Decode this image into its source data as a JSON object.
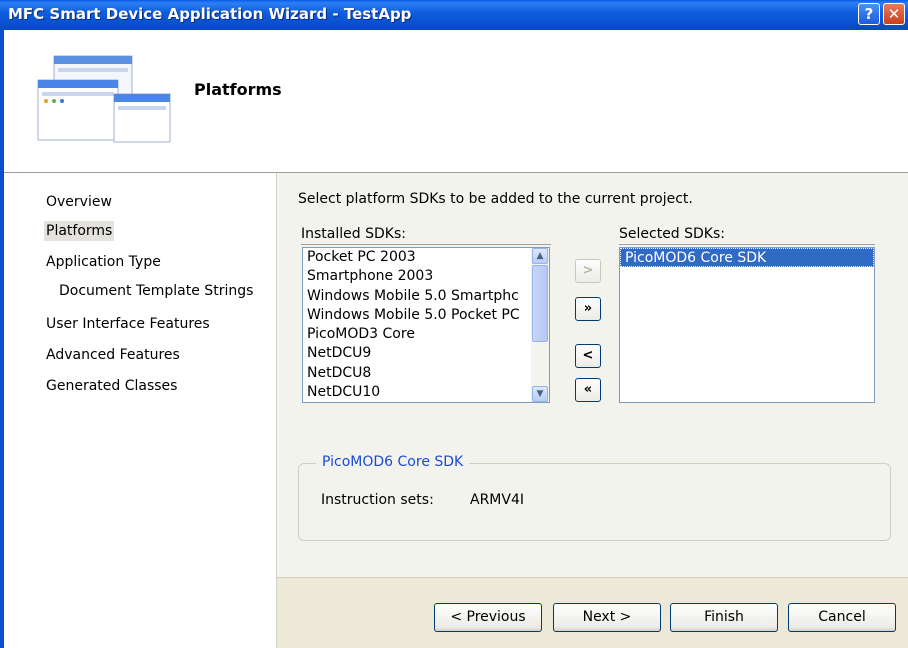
{
  "window": {
    "title": "MFC Smart Device Application Wizard - TestApp",
    "help_label": "?",
    "close_label": "✕"
  },
  "banner": {
    "title": "Platforms",
    "icon": "wizard-windows-icon"
  },
  "nav": {
    "items": [
      {
        "label": "Overview"
      },
      {
        "label": "Platforms",
        "selected": true
      },
      {
        "label": "Application Type"
      },
      {
        "label": "Document Template Strings",
        "indented": true
      },
      {
        "label": "User Interface Features"
      },
      {
        "label": "Advanced Features"
      },
      {
        "label": "Generated Classes"
      }
    ]
  },
  "main": {
    "instruction": "Select platform SDKs to be added to the current project.",
    "installed_label": "Installed SDKs:",
    "selected_label": "Selected SDKs:",
    "installed_sdks": [
      "Pocket PC 2003",
      "Smartphone 2003",
      "Windows Mobile 5.0 Smartphc",
      "Windows Mobile 5.0 Pocket PC",
      "PicoMOD3 Core",
      "NetDCU9",
      "NetDCU8",
      "NetDCU10"
    ],
    "selected_sdks": [
      "PicoMOD6 Core SDK"
    ],
    "move_buttons": {
      "add": ">",
      "add_all": "»",
      "remove": "<",
      "remove_all": "«"
    },
    "details": {
      "group_title": "PicoMOD6 Core SDK",
      "instruction_sets_label": "Instruction sets:",
      "instruction_sets_value": "ARMV4I"
    }
  },
  "footer": {
    "previous": "< Previous",
    "next": "Next >",
    "finish": "Finish",
    "cancel": "Cancel"
  },
  "colors": {
    "title_bar": "#0a5ee6",
    "selection": "#316ac5",
    "group_title": "#1c4bd0"
  }
}
